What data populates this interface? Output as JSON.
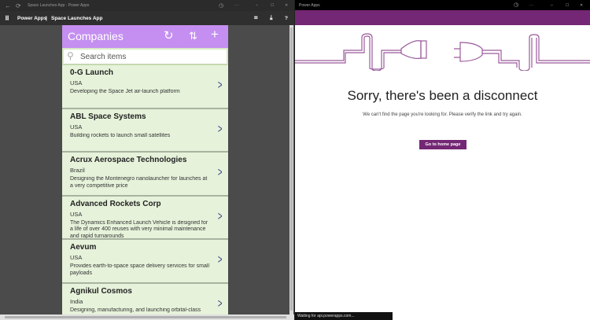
{
  "left_window": {
    "title": "Space Launches App - Power Apps",
    "app_bar": {
      "brand": "Power Apps",
      "separator": "|",
      "app_name": "Space Launches App"
    }
  },
  "app": {
    "header_title": "Companies",
    "search_placeholder": "Search items",
    "items": [
      {
        "name": "0-G Launch",
        "country": "USA",
        "description": "Developing the Space Jet air-launch platform"
      },
      {
        "name": "ABL Space Systems",
        "country": "USA",
        "description": "Building rockets to launch small satellites"
      },
      {
        "name": "Acrux Aerospace Technologies",
        "country": "Brazil",
        "description": "Designing the Montenegro nanolauncher for launches at a very competitive price"
      },
      {
        "name": "Advanced Rockets Corp",
        "country": "USA",
        "description": "The Dynamics Enhanced Launch Vehicle is designed for a life of over 400 reuses with very minimal maintenance and rapid turnarounds"
      },
      {
        "name": "Aevum",
        "country": "USA",
        "description": "Provides earth-to-space space delivery services for small payloads"
      },
      {
        "name": "Agnikul Cosmos",
        "country": "India",
        "description": "Designing, manufacturing, and launching orbital-class"
      }
    ]
  },
  "right_window": {
    "title": "Power Apps",
    "heading": "Sorry, there's been a disconnect",
    "message": "We can't find the page you're looking for. Please verify the link and try again.",
    "button": "Go to home page",
    "status": "Waiting for api.powerapps.com..."
  },
  "colors": {
    "header": "#c48ff0",
    "item_bg": "#e6f2da",
    "brand_purple": "#742774"
  }
}
